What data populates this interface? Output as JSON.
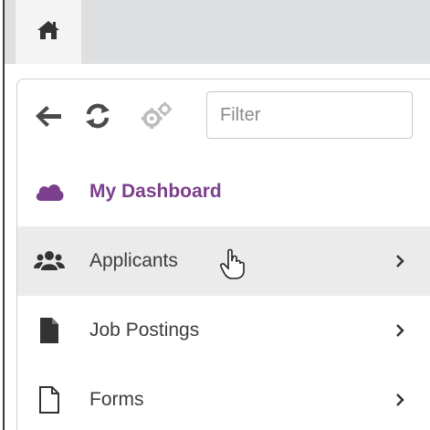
{
  "topbar": {
    "home_icon": "home-icon"
  },
  "toolbar": {
    "back_icon": "arrow-left-icon",
    "refresh_icon": "refresh-icon",
    "settings_icon": "gears-icon",
    "filter_placeholder": "Filter",
    "filter_value": ""
  },
  "menu": {
    "items": [
      {
        "label": "My Dashboard",
        "icon": "cloud-icon",
        "active": true,
        "has_submenu": false
      },
      {
        "label": "Applicants",
        "icon": "users-icon",
        "active": false,
        "has_submenu": true,
        "hovered": true
      },
      {
        "label": "Job Postings",
        "icon": "file-icon",
        "active": false,
        "has_submenu": true
      },
      {
        "label": "Forms",
        "icon": "file-outline-icon",
        "active": false,
        "has_submenu": true
      }
    ]
  },
  "colors": {
    "accent": "#7b3f8c",
    "text": "#3d3d3d",
    "hover_bg": "#ebebeb",
    "topbar_bg": "#dedfe0"
  }
}
